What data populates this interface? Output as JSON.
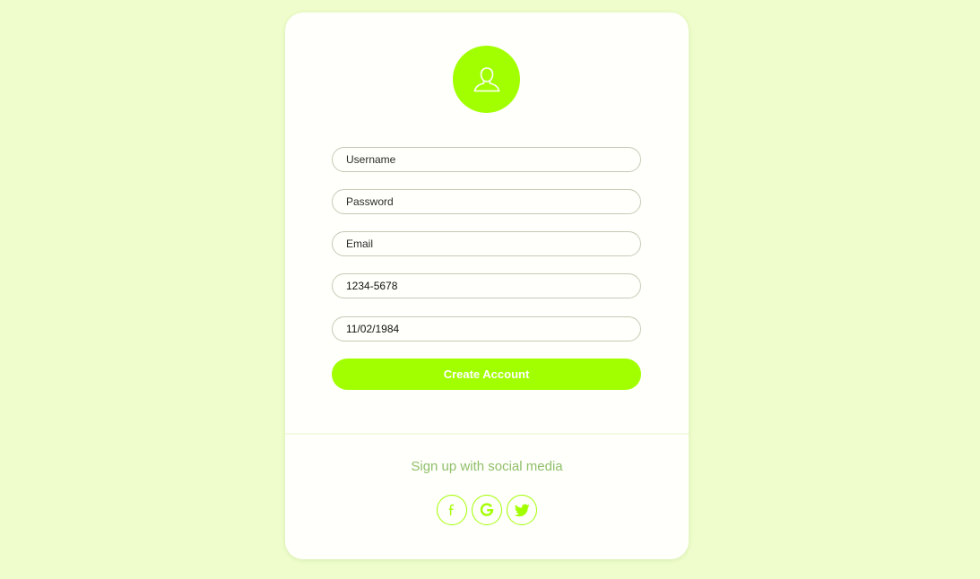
{
  "form": {
    "username_placeholder": "Username",
    "password_placeholder": "Password",
    "email_placeholder": "Email",
    "phone_value": "1234-5678",
    "date_value": "11/02/1984",
    "submit_label": "Create Account"
  },
  "social": {
    "heading": "Sign up with social media",
    "icons": [
      "facebook-icon",
      "google-icon",
      "twitter-icon"
    ]
  },
  "colors": {
    "background": "#eefdcb",
    "accent": "#a2ff00",
    "card": "#fffffb",
    "social_text": "#8fbf6a"
  }
}
